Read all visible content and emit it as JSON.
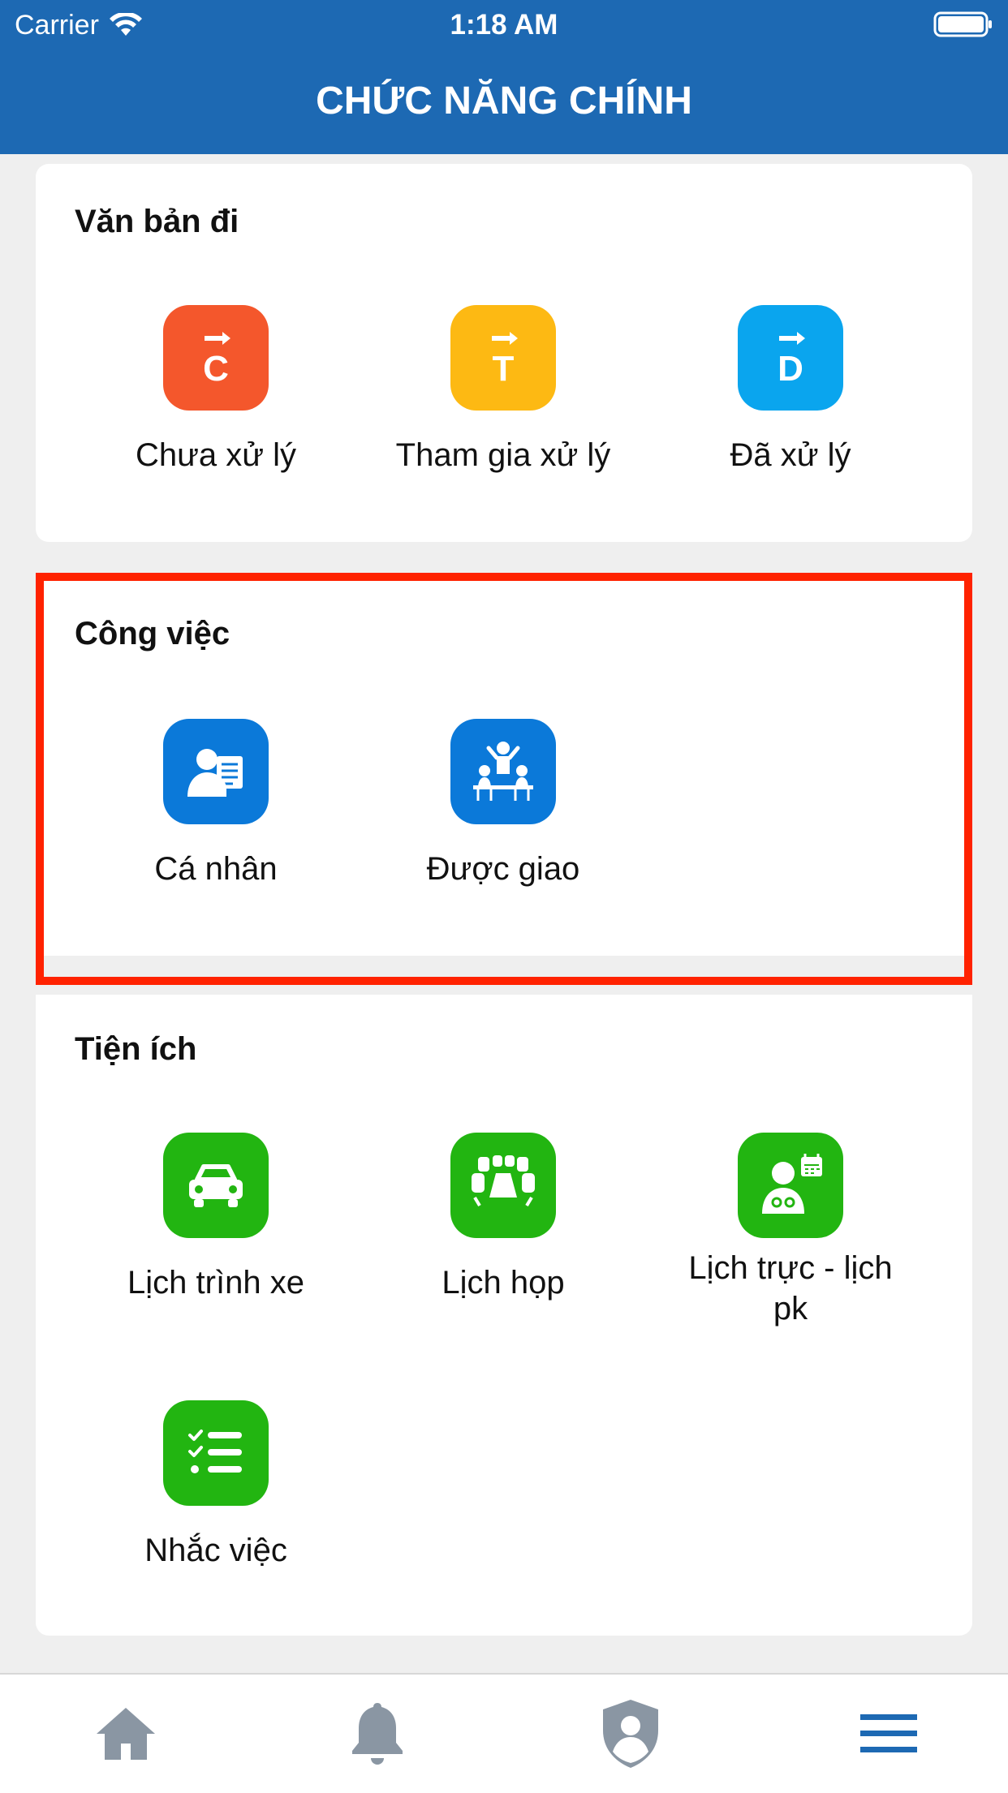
{
  "status_bar": {
    "carrier": "Carrier",
    "time": "1:18 AM"
  },
  "header": {
    "title": "CHỨC NĂNG CHÍNH"
  },
  "sections": {
    "van_ban_di": {
      "title": "Văn bản đi",
      "items": [
        {
          "label": "Chưa xử lý",
          "icon": "arrow-c-icon",
          "letter": "C",
          "color": "#f4572c"
        },
        {
          "label": "Tham gia xử lý",
          "icon": "arrow-t-icon",
          "letter": "T",
          "color": "#fdb913"
        },
        {
          "label": "Đã xử lý",
          "icon": "arrow-d-icon",
          "letter": "D",
          "color": "#0aa5ee"
        }
      ]
    },
    "cong_viec": {
      "title": "Công việc",
      "items": [
        {
          "label": "Cá nhân",
          "icon": "person-document-icon",
          "color": "#0b79d9"
        },
        {
          "label": "Được giao",
          "icon": "meeting-people-icon",
          "color": "#0b79d9"
        }
      ]
    },
    "tien_ich": {
      "title": "Tiện ích",
      "items": [
        {
          "label": "Lịch trình xe",
          "icon": "car-icon",
          "color": "#22b511"
        },
        {
          "label": "Lịch họp",
          "icon": "conference-table-icon",
          "color": "#22b511"
        },
        {
          "label": "Lịch trực - lịch pk",
          "icon": "doctor-calendar-icon",
          "color": "#22b511"
        },
        {
          "label": "Nhắc việc",
          "icon": "checklist-icon",
          "color": "#22b511"
        }
      ]
    }
  },
  "tabbar": {
    "items": [
      "home-icon",
      "bell-icon",
      "shield-user-icon",
      "menu-icon"
    ],
    "active": "menu-icon",
    "active_color": "#1d69b3",
    "inactive_color": "#8a96a3"
  }
}
